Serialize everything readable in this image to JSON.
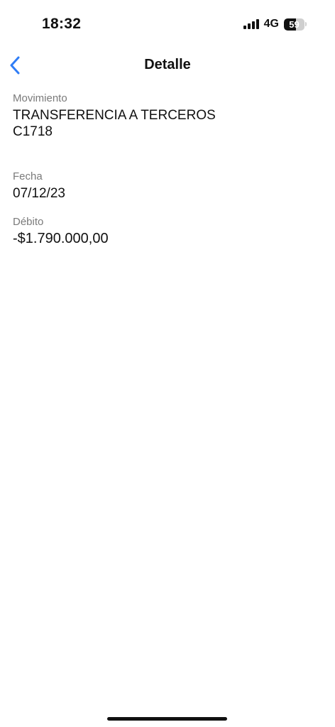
{
  "status_bar": {
    "time": "18:32",
    "network": "4G",
    "battery_level": "59",
    "battery_fraction": 0.59,
    "signal_bars": 4
  },
  "nav": {
    "title": "Detalle",
    "back_icon": "chevron-left-icon",
    "accent_color": "#2f7df6"
  },
  "detail": {
    "movimiento": {
      "label": "Movimiento",
      "line1": "TRANSFERENCIA A TERCEROS",
      "line2": "C1718"
    },
    "fecha": {
      "label": "Fecha",
      "value": "07/12/23"
    },
    "debito": {
      "label": "Débito",
      "value": "-$1.790.000,00"
    }
  }
}
